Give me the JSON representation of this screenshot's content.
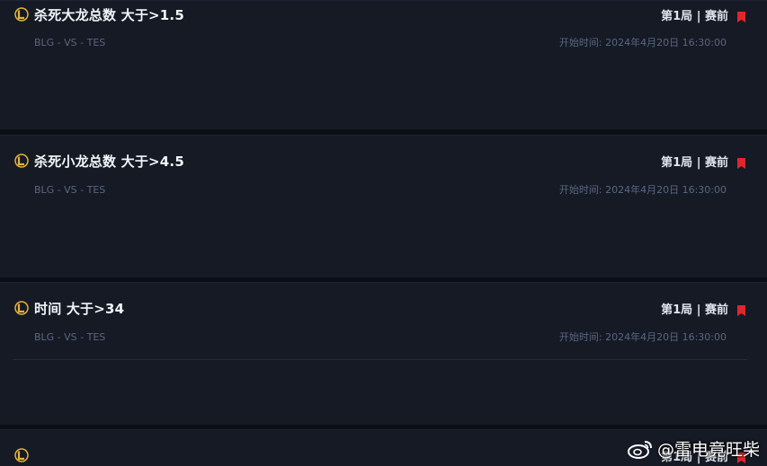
{
  "markets": [
    {
      "title": "杀死大龙总数 大于>1.5",
      "status": "第1局 | 赛前",
      "teams": "BLG - VS - TES",
      "start_time": "开始时间: 2024年4月20日 16:30:00"
    },
    {
      "title": "杀死小龙总数 大于>4.5",
      "status": "第1局 | 赛前",
      "teams": "BLG - VS - TES",
      "start_time": "开始时间: 2024年4月20日 16:30:00"
    },
    {
      "title": "时间 大于>34",
      "status": "第1局 | 赛前",
      "teams": "BLG - VS - TES",
      "start_time": "开始时间: 2024年4月20日 16:30:00"
    },
    {
      "title": "",
      "status": "第1局 | 赛前",
      "teams": "",
      "start_time": ""
    }
  ],
  "colors": {
    "accent": "#2ec4c9",
    "flag": "#e0262c",
    "lol_gold": "#e3b33a"
  },
  "icons": {
    "game": "lol-icon",
    "flag": "flag-icon",
    "watermark": "weibo-icon"
  },
  "watermark": {
    "text": "@雷电竟旺柴"
  }
}
